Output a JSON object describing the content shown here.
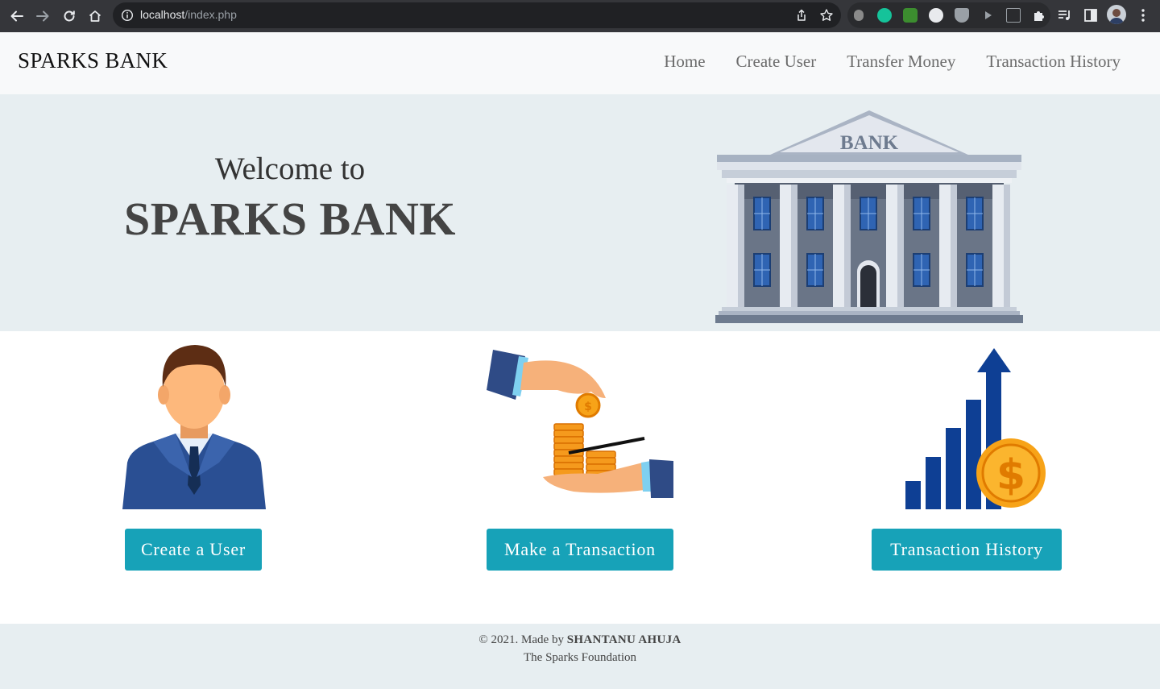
{
  "browser": {
    "url_host": "localhost",
    "url_path": "/index.php"
  },
  "navbar": {
    "brand": "SPARKS BANK",
    "links": [
      "Home",
      "Create User",
      "Transfer Money",
      "Transaction History"
    ]
  },
  "hero": {
    "welcome": "Welcome to",
    "title": "SPARKS BANK",
    "building_sign": "BANK"
  },
  "actions": {
    "create_user": "Create a User",
    "make_transaction": "Make a Transaction",
    "transaction_history": "Transaction History"
  },
  "footer": {
    "copyright_prefix": "© 2021. Made by",
    "author": "SHANTANU AHUJA",
    "organization": "The Sparks Foundation"
  },
  "colors": {
    "accent": "#17a2b8",
    "hero_bg": "#e7eef1",
    "navbar_bg": "#f8f9fa"
  }
}
